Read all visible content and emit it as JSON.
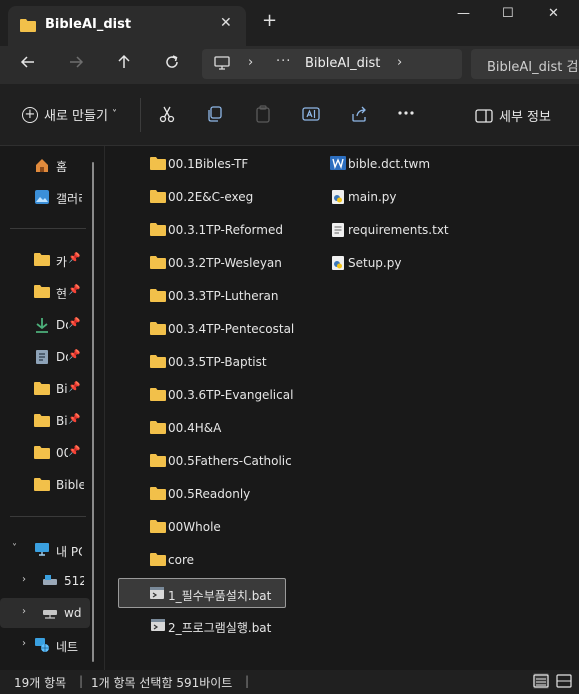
{
  "window": {
    "tab_title": "BibleAI_dist",
    "tab_close": "✕",
    "new_tab": "+",
    "minimize": "—",
    "maximize": "☐",
    "close": "✕"
  },
  "address": {
    "crumb_dots": "···",
    "crumb": "BibleAI_dist",
    "search_text": "BibleAI_dist 검"
  },
  "commands": {
    "new_label": "새로 만들기",
    "detail_label": "세부 정보"
  },
  "sidebar": {
    "items": [
      {
        "label": "홈",
        "icon": "home-icon"
      },
      {
        "label": "갤러리",
        "icon": "gallery-icon"
      },
      {
        "label": "카",
        "icon": "folder-icon",
        "pinned": true
      },
      {
        "label": "현",
        "icon": "folder-icon",
        "pinned": true
      },
      {
        "label": "Do",
        "icon": "download-icon",
        "pinned": true
      },
      {
        "label": "Do",
        "icon": "document-icon",
        "pinned": true
      },
      {
        "label": "Bi",
        "icon": "folder-icon",
        "pinned": true
      },
      {
        "label": "Bi",
        "icon": "folder-icon",
        "pinned": true
      },
      {
        "label": "00",
        "icon": "folder-icon",
        "pinned": true
      },
      {
        "label": "Bible",
        "icon": "folder-icon",
        "pinned": false
      },
      {
        "label": "내 PC",
        "icon": "pc-icon"
      },
      {
        "label": "512",
        "icon": "drive-icon"
      },
      {
        "label": "wd",
        "icon": "network-drive-icon"
      },
      {
        "label": "네트",
        "icon": "network-icon"
      }
    ]
  },
  "files": {
    "folders": [
      "00.1Bibles-TF",
      "00.2E&C-exeg",
      "00.3.1TP-Reformed",
      "00.3.2TP-Wesleyan",
      "00.3.3TP-Lutheran",
      "00.3.4TP-Pentecostal",
      "00.3.5TP-Baptist",
      "00.3.6TP-Evangelical",
      "00.4H&A",
      "00.5Fathers-Catholic",
      "00.5Readonly",
      "00Whole",
      "core",
      "1_필수부품설치.bat",
      "2_프로그램실행.bat"
    ],
    "col2": [
      "bible.dct.twm",
      "main.py",
      "requirements.txt",
      "Setup.py"
    ]
  },
  "status": {
    "count": "19개 항목",
    "selection": "1개 항목 선택함 591바이트",
    "divider": "|"
  },
  "colors": {
    "folder": "#f2c04a",
    "background": "#191919",
    "chrome": "#202020"
  }
}
